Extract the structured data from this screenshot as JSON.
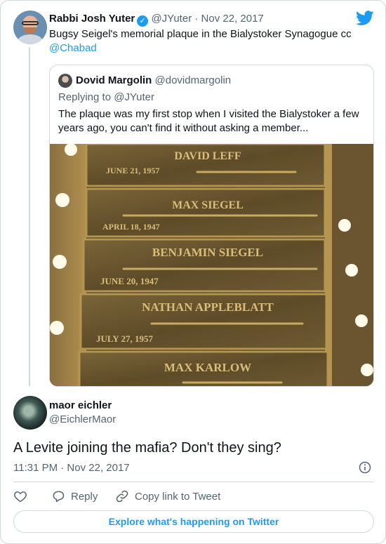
{
  "tweet": {
    "author_name": "Rabbi Josh Yuter",
    "verified_icon": "verified-badge-icon",
    "handle": "@JYuter",
    "separator": "·",
    "date": "Nov 22, 2017",
    "text": "Bugsy Seigel's memorial plaque in the Bialystoker Synagogue cc",
    "mention": "@Chabad"
  },
  "quoted": {
    "author_name": "Dovid Margolin",
    "handle": "@dovidmargolin",
    "replying_to": "Replying to @JYuter",
    "text": "The plaque was my first stop when I visited the Bialystoker a few years ago, you can't find it without asking a member...",
    "photo": {
      "plaques": [
        {
          "name": "DAVID LEFF",
          "date": "JUNE 21, 1957"
        },
        {
          "name": "MAX SIEGEL",
          "date": "APRIL 18, 1947"
        },
        {
          "name": "BENJAMIN SIEGEL",
          "date": "JUNE 20, 1947"
        },
        {
          "name": "NATHAN APPLEBLATT",
          "date": "JULY 27, 1957"
        },
        {
          "name": "MAX KARLOW",
          "date": ""
        }
      ]
    }
  },
  "reply": {
    "author_name": "maor eichler",
    "handle": "@EichlerMaor",
    "text": "A Levite joining the mafia? Don't they sing?",
    "timestamp": "11:31 PM · Nov 22, 2017"
  },
  "actions": {
    "like_icon": "heart-icon",
    "reply_label": "Reply",
    "copy_link_label": "Copy link to Tweet"
  },
  "explore_label": "Explore what's happening on Twitter",
  "colors": {
    "accent": "#1d9bf0",
    "border": "#cfd9de",
    "muted_text": "#536471",
    "text": "#0f1419"
  }
}
